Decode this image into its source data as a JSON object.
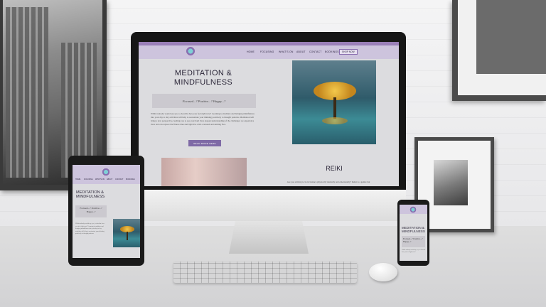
{
  "desktop_site": {
    "nav": [
      "HOME",
      "FOCUSING",
      "WHAT'S ON",
      "ABOUT",
      "CONTACT",
      "BOOKINGS"
    ],
    "nav_button": "SHOP NOW",
    "hero": {
      "title": "MEDITATION & MINDFULNESS",
      "tagline": "Focused...? Positive...? Happy...?",
      "body": "Whilst nobody would say yes, to describe how you feel right now? Learning to meditate and bringing mindfulness into your day to day activities will help to reorientate your thinking positively to thought patterns. Meditation will bring a new perspective, leading you to see your hard lives deepen understanding of the challenges we experience lives and can replace the fitness blue and light live with a relaxed and smiling face.",
      "button": "READ MORE HERE"
    },
    "reiki": {
      "title": "REIKI",
      "body": "Are you striving to be in balance physically mentally and emotionally? Reiki is a gentle but"
    }
  },
  "tablet_site": {
    "nav": [
      "HOME",
      "FOCUSING",
      "WHAT'S ON",
      "ABOUT",
      "CONTACT",
      "BOOKINGS"
    ],
    "title": "MEDITATION & MINDFULNESS",
    "tagline": "Focused...? Positive...? Happy...?",
    "body": "Whilst nobody would say yes, to describe how you feel right now? Learning to meditate and bringing mindfulness into your day to day activities will help to reorientate your thinking positively to thought patterns."
  },
  "phone_site": {
    "title": "MEDITATION & MINDFULNESS",
    "tagline": "Focused...? Positive...? Happy...?",
    "body": "Whilst nobody would say yes, to describe how you feel right now?"
  },
  "colors": {
    "brand_purple": "#8a6fb0",
    "nav_lilac": "#cdc4dd",
    "button_purple": "#7f6aa6"
  },
  "icons": [
    "lotus-logo-icon"
  ]
}
